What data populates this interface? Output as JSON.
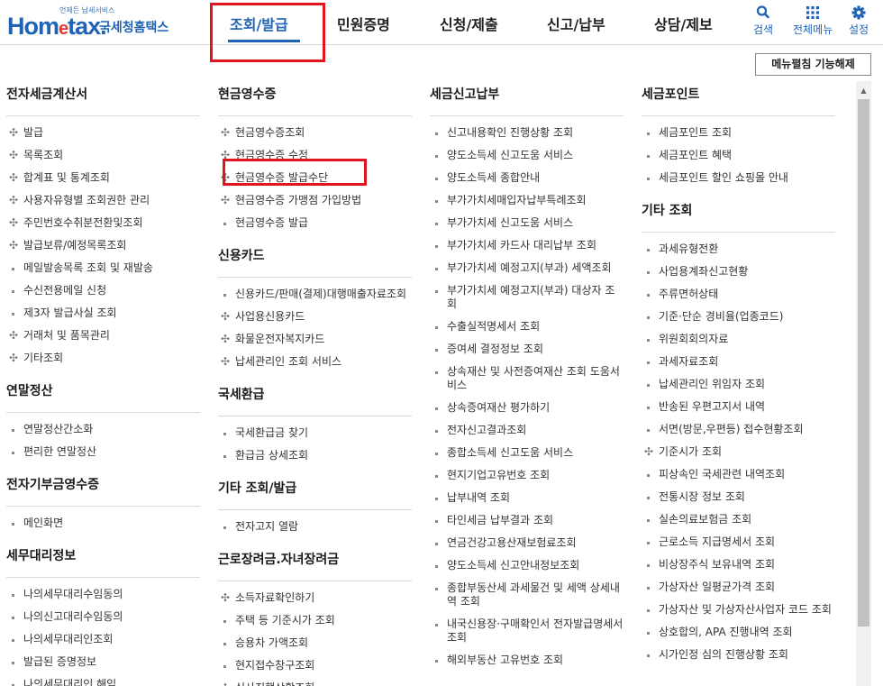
{
  "header": {
    "logo": {
      "small": "언제든 납세서비스",
      "main_a": "Hom",
      "main_e": "e",
      "main_b": "tax.",
      "kr": "국세청홈택스"
    },
    "nav": [
      "조회/발급",
      "민원증명",
      "신청/제출",
      "신고/납부",
      "상담/제보"
    ],
    "util": {
      "search": "검색",
      "all_menu": "전체메뉴",
      "settings": "설정"
    },
    "collapse_button": "메뉴펼침 기능해제"
  },
  "columns": [
    {
      "sections": [
        {
          "title": "전자세금계산서",
          "items": [
            {
              "t": "발급",
              "m": "plus"
            },
            {
              "t": "목록조회",
              "m": "plus"
            },
            {
              "t": "합계표 및 통계조회",
              "m": "plus"
            },
            {
              "t": "사용자유형별 조회권한 관리",
              "m": "plus"
            },
            {
              "t": "주민번호수취분전환및조회",
              "m": "plus"
            },
            {
              "t": "발급보류/예정목록조회",
              "m": "plus"
            },
            {
              "t": "메일발송목록 조회 및 재발송",
              "m": "dot"
            },
            {
              "t": "수신전용메일 신청",
              "m": "dot"
            },
            {
              "t": "제3자 발급사실 조회",
              "m": "dot"
            },
            {
              "t": "거래처 및 품목관리",
              "m": "plus"
            },
            {
              "t": "기타조회",
              "m": "plus"
            }
          ]
        },
        {
          "title": "연말정산",
          "items": [
            {
              "t": "연말정산간소화",
              "m": "dot"
            },
            {
              "t": "편리한 연말정산",
              "m": "dot"
            }
          ]
        },
        {
          "title": "전자기부금영수증",
          "items": [
            {
              "t": "메인화면",
              "m": "dot"
            }
          ]
        },
        {
          "title": "세무대리정보",
          "items": [
            {
              "t": "나의세무대리수임동의",
              "m": "dot"
            },
            {
              "t": "나의신고대리수임동의",
              "m": "dot"
            },
            {
              "t": "나의세무대리인조회",
              "m": "dot"
            },
            {
              "t": "발급된 증명정보",
              "m": "dot"
            },
            {
              "t": "나의세무대리인 해임",
              "m": "dot"
            }
          ]
        }
      ]
    },
    {
      "sections": [
        {
          "title": "현금영수증",
          "items": [
            {
              "t": "현금영수증조회",
              "m": "plus"
            },
            {
              "t": "현금영수증 수정",
              "m": "plus"
            },
            {
              "t": "현금영수증 발급수단",
              "m": "plus"
            },
            {
              "t": "현금영수증 가맹점 가입방법",
              "m": "plus"
            },
            {
              "t": "현금영수증 발급",
              "m": "dot"
            }
          ]
        },
        {
          "title": "신용카드",
          "items": [
            {
              "t": "신용카드/판매(결제)대행매출자료조회",
              "m": "dot"
            },
            {
              "t": "사업용신용카드",
              "m": "plus"
            },
            {
              "t": "화물운전자복지카드",
              "m": "plus"
            },
            {
              "t": "납세관리인 조회 서비스",
              "m": "plus"
            }
          ]
        },
        {
          "title": "국세환급",
          "items": [
            {
              "t": "국세환급금 찾기",
              "m": "dot"
            },
            {
              "t": "환급금 상세조회",
              "m": "dot"
            }
          ]
        },
        {
          "title": "기타 조회/발급",
          "items": [
            {
              "t": "전자고지 열람",
              "m": "dot"
            }
          ]
        },
        {
          "title": "근로장려금.자녀장려금",
          "items": [
            {
              "t": "소득자료확인하기",
              "m": "plus"
            },
            {
              "t": "주택 등 기준시가 조회",
              "m": "dot"
            },
            {
              "t": "승용차 가액조회",
              "m": "dot"
            },
            {
              "t": "현지접수창구조회",
              "m": "dot"
            },
            {
              "t": "심사진행상황조회",
              "m": "plus"
            }
          ]
        }
      ]
    },
    {
      "sections": [
        {
          "title": "세금신고납부",
          "items": [
            {
              "t": "신고내용확인 진행상황 조회",
              "m": "dot"
            },
            {
              "t": "양도소득세 신고도움 서비스",
              "m": "dot"
            },
            {
              "t": "양도소득세 종합안내",
              "m": "dot"
            },
            {
              "t": "부가가치세매입자납부특례조회",
              "m": "dot"
            },
            {
              "t": "부가가치세 신고도움 서비스",
              "m": "dot"
            },
            {
              "t": "부가가치세 카드사 대리납부 조회",
              "m": "dot"
            },
            {
              "t": "부가가치세 예정고지(부과) 세액조회",
              "m": "dot"
            },
            {
              "t": "부가가치세 예정고지(부과) 대상자 조회",
              "m": "dot"
            },
            {
              "t": "수출실적명세서 조회",
              "m": "dot"
            },
            {
              "t": "증여세 결정정보 조회",
              "m": "dot"
            },
            {
              "t": "상속재산 및 사전증여재산 조회 도움서비스",
              "m": "dot"
            },
            {
              "t": "상속증여재산 평가하기",
              "m": "dot"
            },
            {
              "t": "전자신고결과조회",
              "m": "dot"
            },
            {
              "t": "종합소득세 신고도움 서비스",
              "m": "dot"
            },
            {
              "t": "현지기업고유번호 조회",
              "m": "dot"
            },
            {
              "t": "납부내역 조회",
              "m": "dot"
            },
            {
              "t": "타인세금 납부결과 조회",
              "m": "dot"
            },
            {
              "t": "연금건강고용산재보험료조회",
              "m": "dot"
            },
            {
              "t": "양도소득세 신고안내정보조회",
              "m": "dot"
            },
            {
              "t": "종합부동산세 과세물건 및 세액 상세내역 조회",
              "m": "dot"
            },
            {
              "t": "내국신용장·구매확인서 전자발급명세서 조회",
              "m": "dot"
            },
            {
              "t": "해외부동산 고유번호 조회",
              "m": "dot"
            }
          ]
        }
      ]
    },
    {
      "sections": [
        {
          "title": "세금포인트",
          "items": [
            {
              "t": "세금포인트 조회",
              "m": "dot"
            },
            {
              "t": "세금포인트 혜택",
              "m": "dot"
            },
            {
              "t": "세금포인트 할인 쇼핑몰 안내",
              "m": "dot"
            }
          ]
        },
        {
          "title": "기타 조회",
          "items": [
            {
              "t": "과세유형전환",
              "m": "dot"
            },
            {
              "t": "사업용계좌신고현황",
              "m": "dot"
            },
            {
              "t": "주류면허상태",
              "m": "dot"
            },
            {
              "t": "기준·단순 경비율(업종코드)",
              "m": "dot"
            },
            {
              "t": "위원회회의자료",
              "m": "dot"
            },
            {
              "t": "과세자료조회",
              "m": "dot"
            },
            {
              "t": "납세관리인 위임자 조회",
              "m": "dot"
            },
            {
              "t": "반송된 우편고지서 내역",
              "m": "dot"
            },
            {
              "t": "서면(방문,우편등) 접수현황조회",
              "m": "dot"
            },
            {
              "t": "기준시가 조회",
              "m": "plus"
            },
            {
              "t": "피상속인 국세관련 내역조회",
              "m": "dot"
            },
            {
              "t": "전통시장 정보 조회",
              "m": "dot"
            },
            {
              "t": "실손의료보험금 조회",
              "m": "dot"
            },
            {
              "t": "근로소득 지급명세서 조회",
              "m": "dot"
            },
            {
              "t": "비상장주식 보유내역 조회",
              "m": "dot"
            },
            {
              "t": "가상자산 일평균가격 조회",
              "m": "dot"
            },
            {
              "t": "가상자산 및 가상자산사업자 코드 조회",
              "m": "dot"
            },
            {
              "t": "상호합의, APA 진행내역 조회",
              "m": "dot"
            },
            {
              "t": "시가인정 심의 진행상황 조회",
              "m": "dot"
            }
          ]
        }
      ]
    }
  ],
  "colors": {
    "brand": "#1f63b6",
    "highlight": "#e0151f",
    "accent_e": "#e03a2e"
  },
  "icons": {
    "search": "search-icon",
    "all_menu": "grid-icon",
    "settings": "gear-icon",
    "plus": "plus-icon",
    "dot": "bullet-dot"
  }
}
